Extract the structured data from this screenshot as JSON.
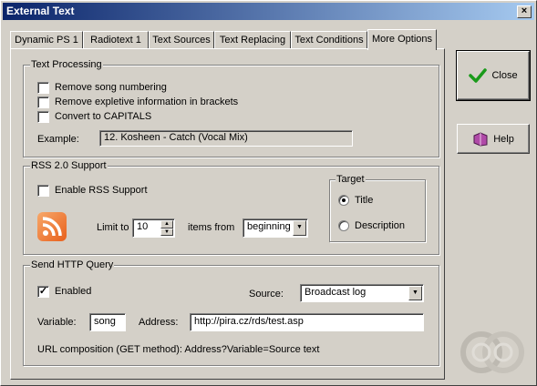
{
  "window": {
    "title": "External Text"
  },
  "tabs": [
    {
      "label": "Dynamic PS 1"
    },
    {
      "label": "Radiotext 1"
    },
    {
      "label": "Text Sources"
    },
    {
      "label": "Text Replacing"
    },
    {
      "label": "Text Conditions"
    },
    {
      "label": "More Options"
    }
  ],
  "active_tab": "More Options",
  "text_processing": {
    "legend": "Text Processing",
    "remove_numbering": {
      "label": "Remove song numbering",
      "checked": false
    },
    "remove_expletive": {
      "label": "Remove expletive information in brackets",
      "checked": false
    },
    "capitals": {
      "label": "Convert to CAPITALS",
      "checked": false
    },
    "example_label": "Example:",
    "example_value": "12. Kosheen - Catch (Vocal Mix)"
  },
  "rss": {
    "legend": "RSS 2.0 Support",
    "enable": {
      "label": "Enable RSS Support",
      "checked": false
    },
    "limit_label": "Limit to",
    "limit_value": "10",
    "items_from_label": "items from",
    "items_from_value": "beginning",
    "target_legend": "Target",
    "target_title": "Title",
    "target_description": "Description",
    "target_selected": "Title",
    "icon": "rss-feed-icon"
  },
  "http": {
    "legend": "Send HTTP Query",
    "enabled": {
      "label": "Enabled",
      "checked": true
    },
    "source_label": "Source:",
    "source_value": "Broadcast log",
    "variable_label": "Variable:",
    "variable_value": "song",
    "address_label": "Address:",
    "address_value": "http://pira.cz/rds/test.asp",
    "url_note": "URL composition (GET method): Address?Variable=Source text"
  },
  "buttons": {
    "close_label": "Close",
    "help_label": "Help"
  },
  "colors": {
    "titlebar_start": "#0a246a",
    "titlebar_end": "#a6caf0",
    "face": "#d4d0c8",
    "check_green": "#1a9a1a"
  }
}
